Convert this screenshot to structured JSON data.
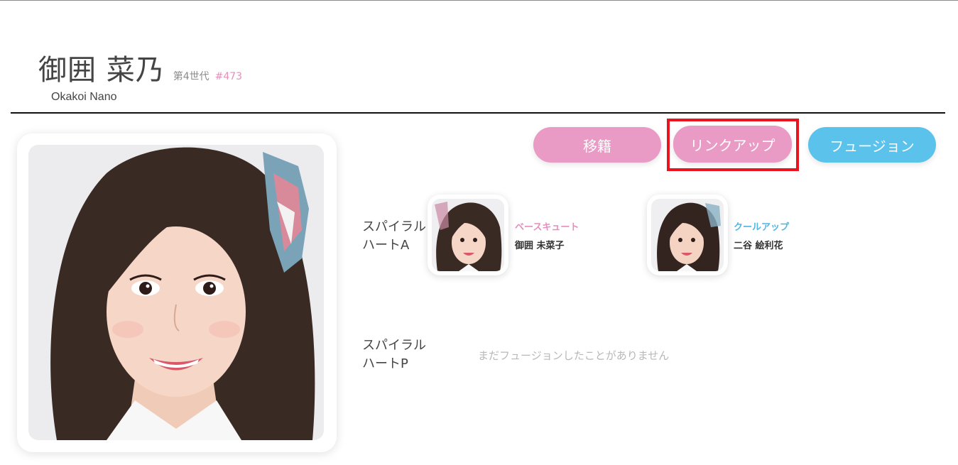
{
  "profile": {
    "name": "御囲 菜乃",
    "generation": "第4世代",
    "number": "#473",
    "romaji": "Okakoi Nano"
  },
  "actions": {
    "transfer": "移籍",
    "linkup": "リンクアップ",
    "fusion": "フュージョン"
  },
  "spiral_a": {
    "label": "スパイラル\nハートA",
    "label_line1": "スパイラル",
    "label_line2": "ハートA",
    "partners": [
      {
        "type": "ベースキュート",
        "name": "御囲 未菜子",
        "type_color": "#e58fbd"
      },
      {
        "type": "クールアップ",
        "name": "二谷 絵利花",
        "type_color": "#4fb6e6"
      }
    ]
  },
  "spiral_p": {
    "label_line1": "スパイラル",
    "label_line2": "ハートP",
    "empty_message": "まだフュージョンしたことがありません"
  },
  "colors": {
    "pink": "#e99bc5",
    "blue": "#5bc2ec",
    "highlight": "#e8141f"
  }
}
